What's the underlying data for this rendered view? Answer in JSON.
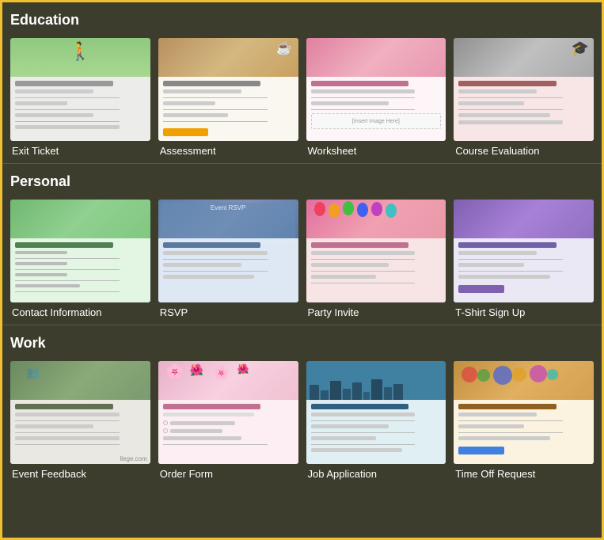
{
  "sections": [
    {
      "id": "education",
      "title": "Education",
      "cards": [
        {
          "id": "exit-ticket",
          "label": "Exit Ticket",
          "thumb": "exit",
          "headerColor": "#a8d880",
          "bgColor": "#f5f5ee"
        },
        {
          "id": "assessment",
          "label": "Assessment",
          "thumb": "assessment",
          "headerColor": "#c8a870",
          "bgColor": "#f5f0e8"
        },
        {
          "id": "worksheet",
          "label": "Worksheet",
          "thumb": "worksheet",
          "headerColor": "#e8a8b8",
          "bgColor": "#f8f0f0"
        },
        {
          "id": "course-evaluation",
          "label": "Course Evaluation",
          "thumb": "course",
          "headerColor": "#c0c0c0",
          "bgColor": "#fce8e8"
        }
      ]
    },
    {
      "id": "personal",
      "title": "Personal",
      "cards": [
        {
          "id": "contact-information",
          "label": "Contact Information",
          "thumb": "contact",
          "headerColor": "#80c880",
          "bgColor": "#e8f8e8"
        },
        {
          "id": "rsvp",
          "label": "RSVP",
          "thumb": "rsvp",
          "headerColor": "#6080b0",
          "bgColor": "#e8eef8"
        },
        {
          "id": "party-invite",
          "label": "Party Invite",
          "thumb": "party",
          "headerColor": "#e898a8",
          "bgColor": "#f8e8e8"
        },
        {
          "id": "tshirt-signup",
          "label": "T-Shirt Sign Up",
          "thumb": "tshirt",
          "headerColor": "#9070c0",
          "bgColor": "#f0eef8"
        }
      ]
    },
    {
      "id": "work",
      "title": "Work",
      "cards": [
        {
          "id": "event-feedback",
          "label": "Event Feedback",
          "thumb": "feedback",
          "headerColor": "#7a9a70",
          "bgColor": "#f0ece8"
        },
        {
          "id": "order-form",
          "label": "Order Form",
          "thumb": "order",
          "headerColor": "#f0c8d8",
          "bgColor": "#fdf0f4"
        },
        {
          "id": "job-application",
          "label": "Job Application",
          "thumb": "job",
          "headerColor": "#4080a0",
          "bgColor": "#e8f4f8"
        },
        {
          "id": "time-off-request",
          "label": "Time Off Request",
          "thumb": "timeoff",
          "headerColor": "#d0a050",
          "bgColor": "#fdf8e8"
        }
      ]
    }
  ]
}
